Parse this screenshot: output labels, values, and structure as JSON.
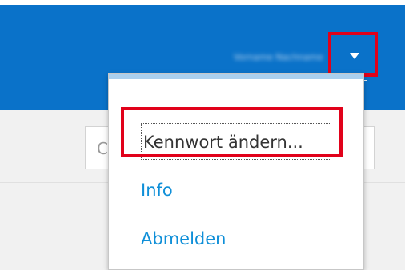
{
  "header": {
    "username": "Vorname Nachname",
    "menu_toggle_icon": "caret-down-icon"
  },
  "search": {
    "visible_letter": "C"
  },
  "user_menu": {
    "items": [
      {
        "label": "Kennwort ändern..."
      },
      {
        "label": "Info"
      },
      {
        "label": "Abmelden"
      }
    ]
  },
  "colors": {
    "header_bg": "#0a72c9",
    "link": "#0f8fd8",
    "highlight": "#e1011a"
  }
}
